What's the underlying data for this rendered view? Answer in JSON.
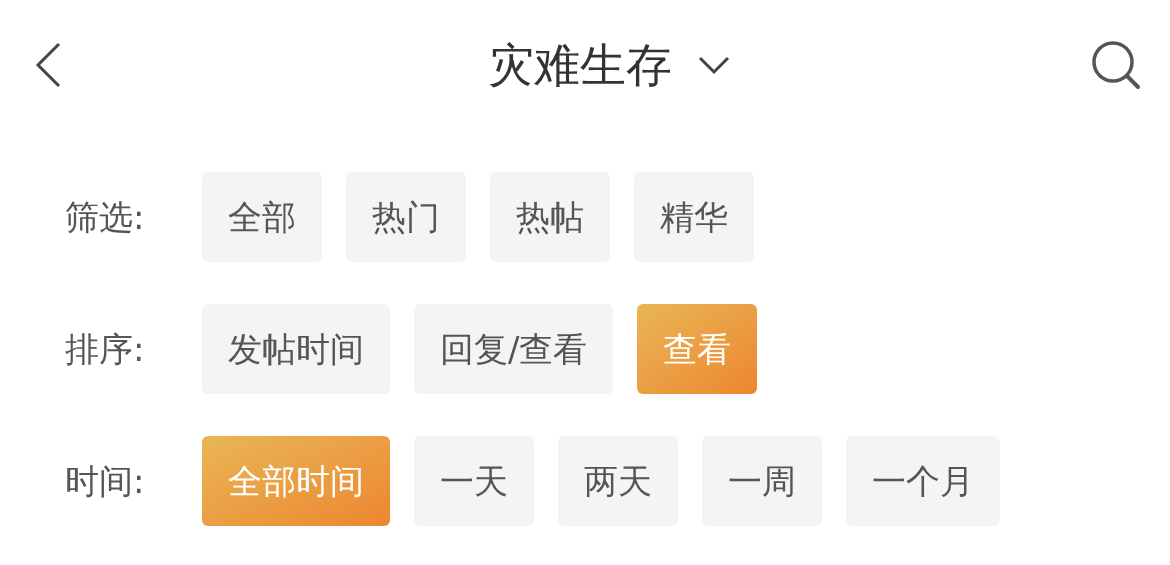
{
  "header": {
    "title": "灾难生存"
  },
  "filters": [
    {
      "label": "筛选:",
      "options": [
        {
          "label": "全部",
          "selected": false
        },
        {
          "label": "热门",
          "selected": false
        },
        {
          "label": "热帖",
          "selected": false
        },
        {
          "label": "精华",
          "selected": false
        }
      ]
    },
    {
      "label": "排序:",
      "options": [
        {
          "label": "发帖时间",
          "selected": false
        },
        {
          "label": "回复/查看",
          "selected": false
        },
        {
          "label": "查看",
          "selected": true
        }
      ]
    },
    {
      "label": "时间:",
      "options": [
        {
          "label": "全部时间",
          "selected": true
        },
        {
          "label": "一天",
          "selected": false
        },
        {
          "label": "两天",
          "selected": false
        },
        {
          "label": "一周",
          "selected": false
        },
        {
          "label": "一个月",
          "selected": false
        }
      ]
    }
  ]
}
